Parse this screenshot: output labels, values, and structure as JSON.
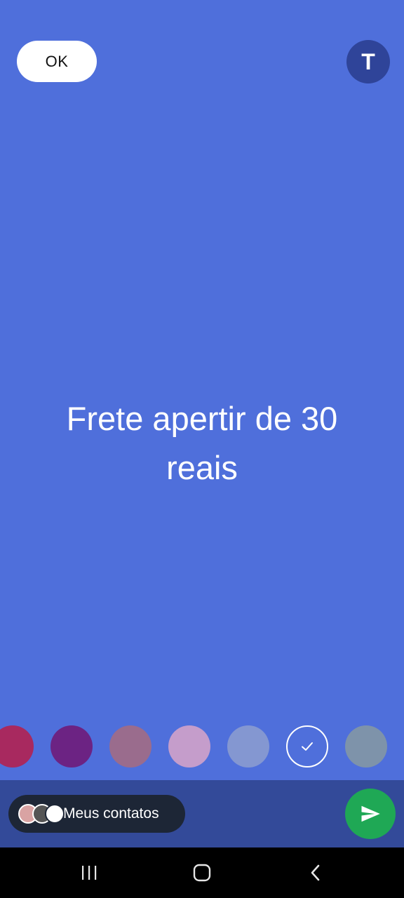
{
  "toolbar": {
    "ok_label": "OK",
    "text_tool_label": "T"
  },
  "status": {
    "text": "Frete apertir de 30 reais",
    "background_color": "#4f6fdb"
  },
  "palette": {
    "colors": [
      "#a8295f",
      "#6c2383",
      "#9a6c8d",
      "#c59dcb",
      "#8497d1",
      "#4f6fdb",
      "#7e93aa"
    ],
    "selected_index": 5
  },
  "audience": {
    "label": "Meus contatos"
  },
  "icons": {
    "send": "send-icon",
    "check": "check-icon",
    "recents": "recents-icon",
    "home": "home-icon",
    "back": "back-icon"
  }
}
